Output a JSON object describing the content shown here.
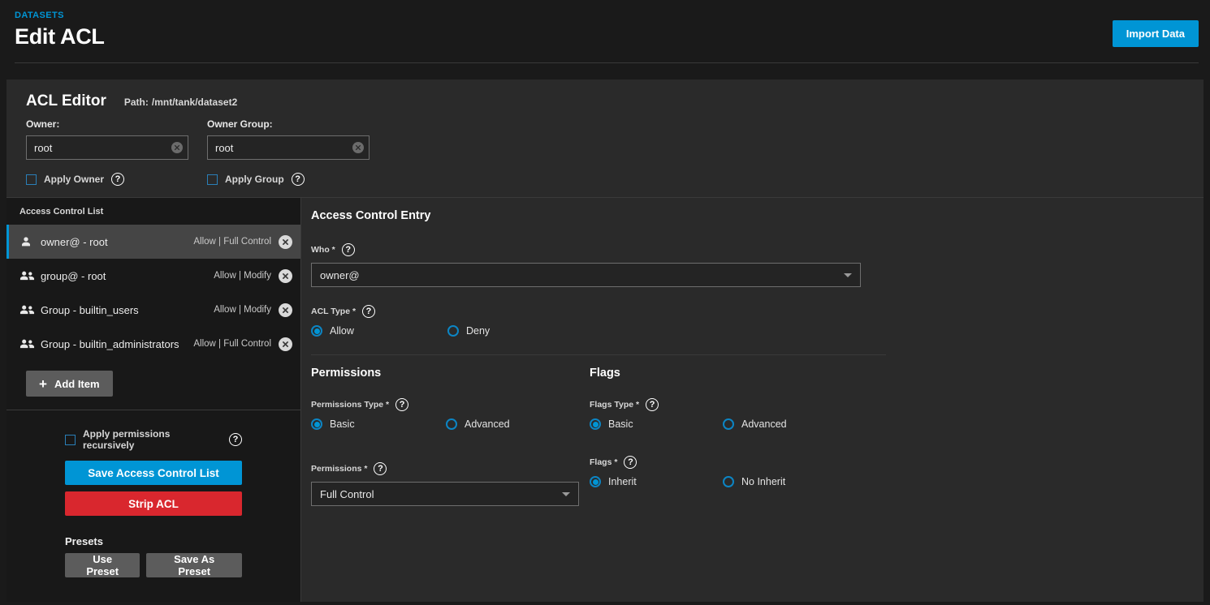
{
  "header": {
    "breadcrumb": "DATASETS",
    "title": "Edit ACL",
    "import_button": "Import Data"
  },
  "acl_editor": {
    "title": "ACL Editor",
    "path_label": "Path:",
    "path_value": "/mnt/tank/dataset2",
    "owner": {
      "label": "Owner:",
      "value": "root",
      "apply_label": "Apply Owner",
      "apply_checked": false
    },
    "owner_group": {
      "label": "Owner Group:",
      "value": "root",
      "apply_label": "Apply Group",
      "apply_checked": false
    }
  },
  "access_control_list": {
    "header": "Access Control List",
    "items": [
      {
        "label": "owner@ - root",
        "permission": "Allow | Full Control",
        "icon": "person-icon",
        "selected": true
      },
      {
        "label": "group@ - root",
        "permission": "Allow | Modify",
        "icon": "people-icon",
        "selected": false
      },
      {
        "label": "Group - builtin_users",
        "permission": "Allow | Modify",
        "icon": "people-icon",
        "selected": false
      },
      {
        "label": "Group - builtin_administrators",
        "permission": "Allow | Full Control",
        "icon": "people-icon",
        "selected": false
      }
    ],
    "add_item_label": "Add Item"
  },
  "left_actions": {
    "recursive_label": "Apply permissions recursively",
    "recursive_checked": false,
    "save_label": "Save Access Control List",
    "strip_label": "Strip ACL",
    "presets_title": "Presets",
    "use_preset_label": "Use Preset",
    "save_as_preset_label": "Save As Preset"
  },
  "access_control_entry": {
    "title": "Access Control Entry",
    "who": {
      "label": "Who *",
      "value": "owner@"
    },
    "acl_type": {
      "label": "ACL Type *",
      "options": [
        {
          "label": "Allow",
          "selected": true
        },
        {
          "label": "Deny",
          "selected": false
        }
      ]
    },
    "permissions": {
      "title": "Permissions",
      "type_label": "Permissions Type *",
      "type_options": [
        {
          "label": "Basic",
          "selected": true
        },
        {
          "label": "Advanced",
          "selected": false
        }
      ],
      "value_label": "Permissions *",
      "value": "Full Control"
    },
    "flags": {
      "title": "Flags",
      "type_label": "Flags Type *",
      "type_options": [
        {
          "label": "Basic",
          "selected": true
        },
        {
          "label": "Advanced",
          "selected": false
        }
      ],
      "value_label": "Flags *",
      "value_options": [
        {
          "label": "Inherit",
          "selected": true
        },
        {
          "label": "No Inherit",
          "selected": false
        }
      ]
    }
  },
  "icons": {
    "help": "?",
    "plus": "+",
    "clear": "clear-icon",
    "remove": "close-icon",
    "caret": "chevron-down-icon"
  },
  "colors": {
    "accent_blue": "#0095d5",
    "danger_red": "#d9272e",
    "page_bg": "#1a1a1a",
    "card_bg": "#2a2a2a",
    "panel_bg": "#181818",
    "selected_row": "#454545"
  }
}
